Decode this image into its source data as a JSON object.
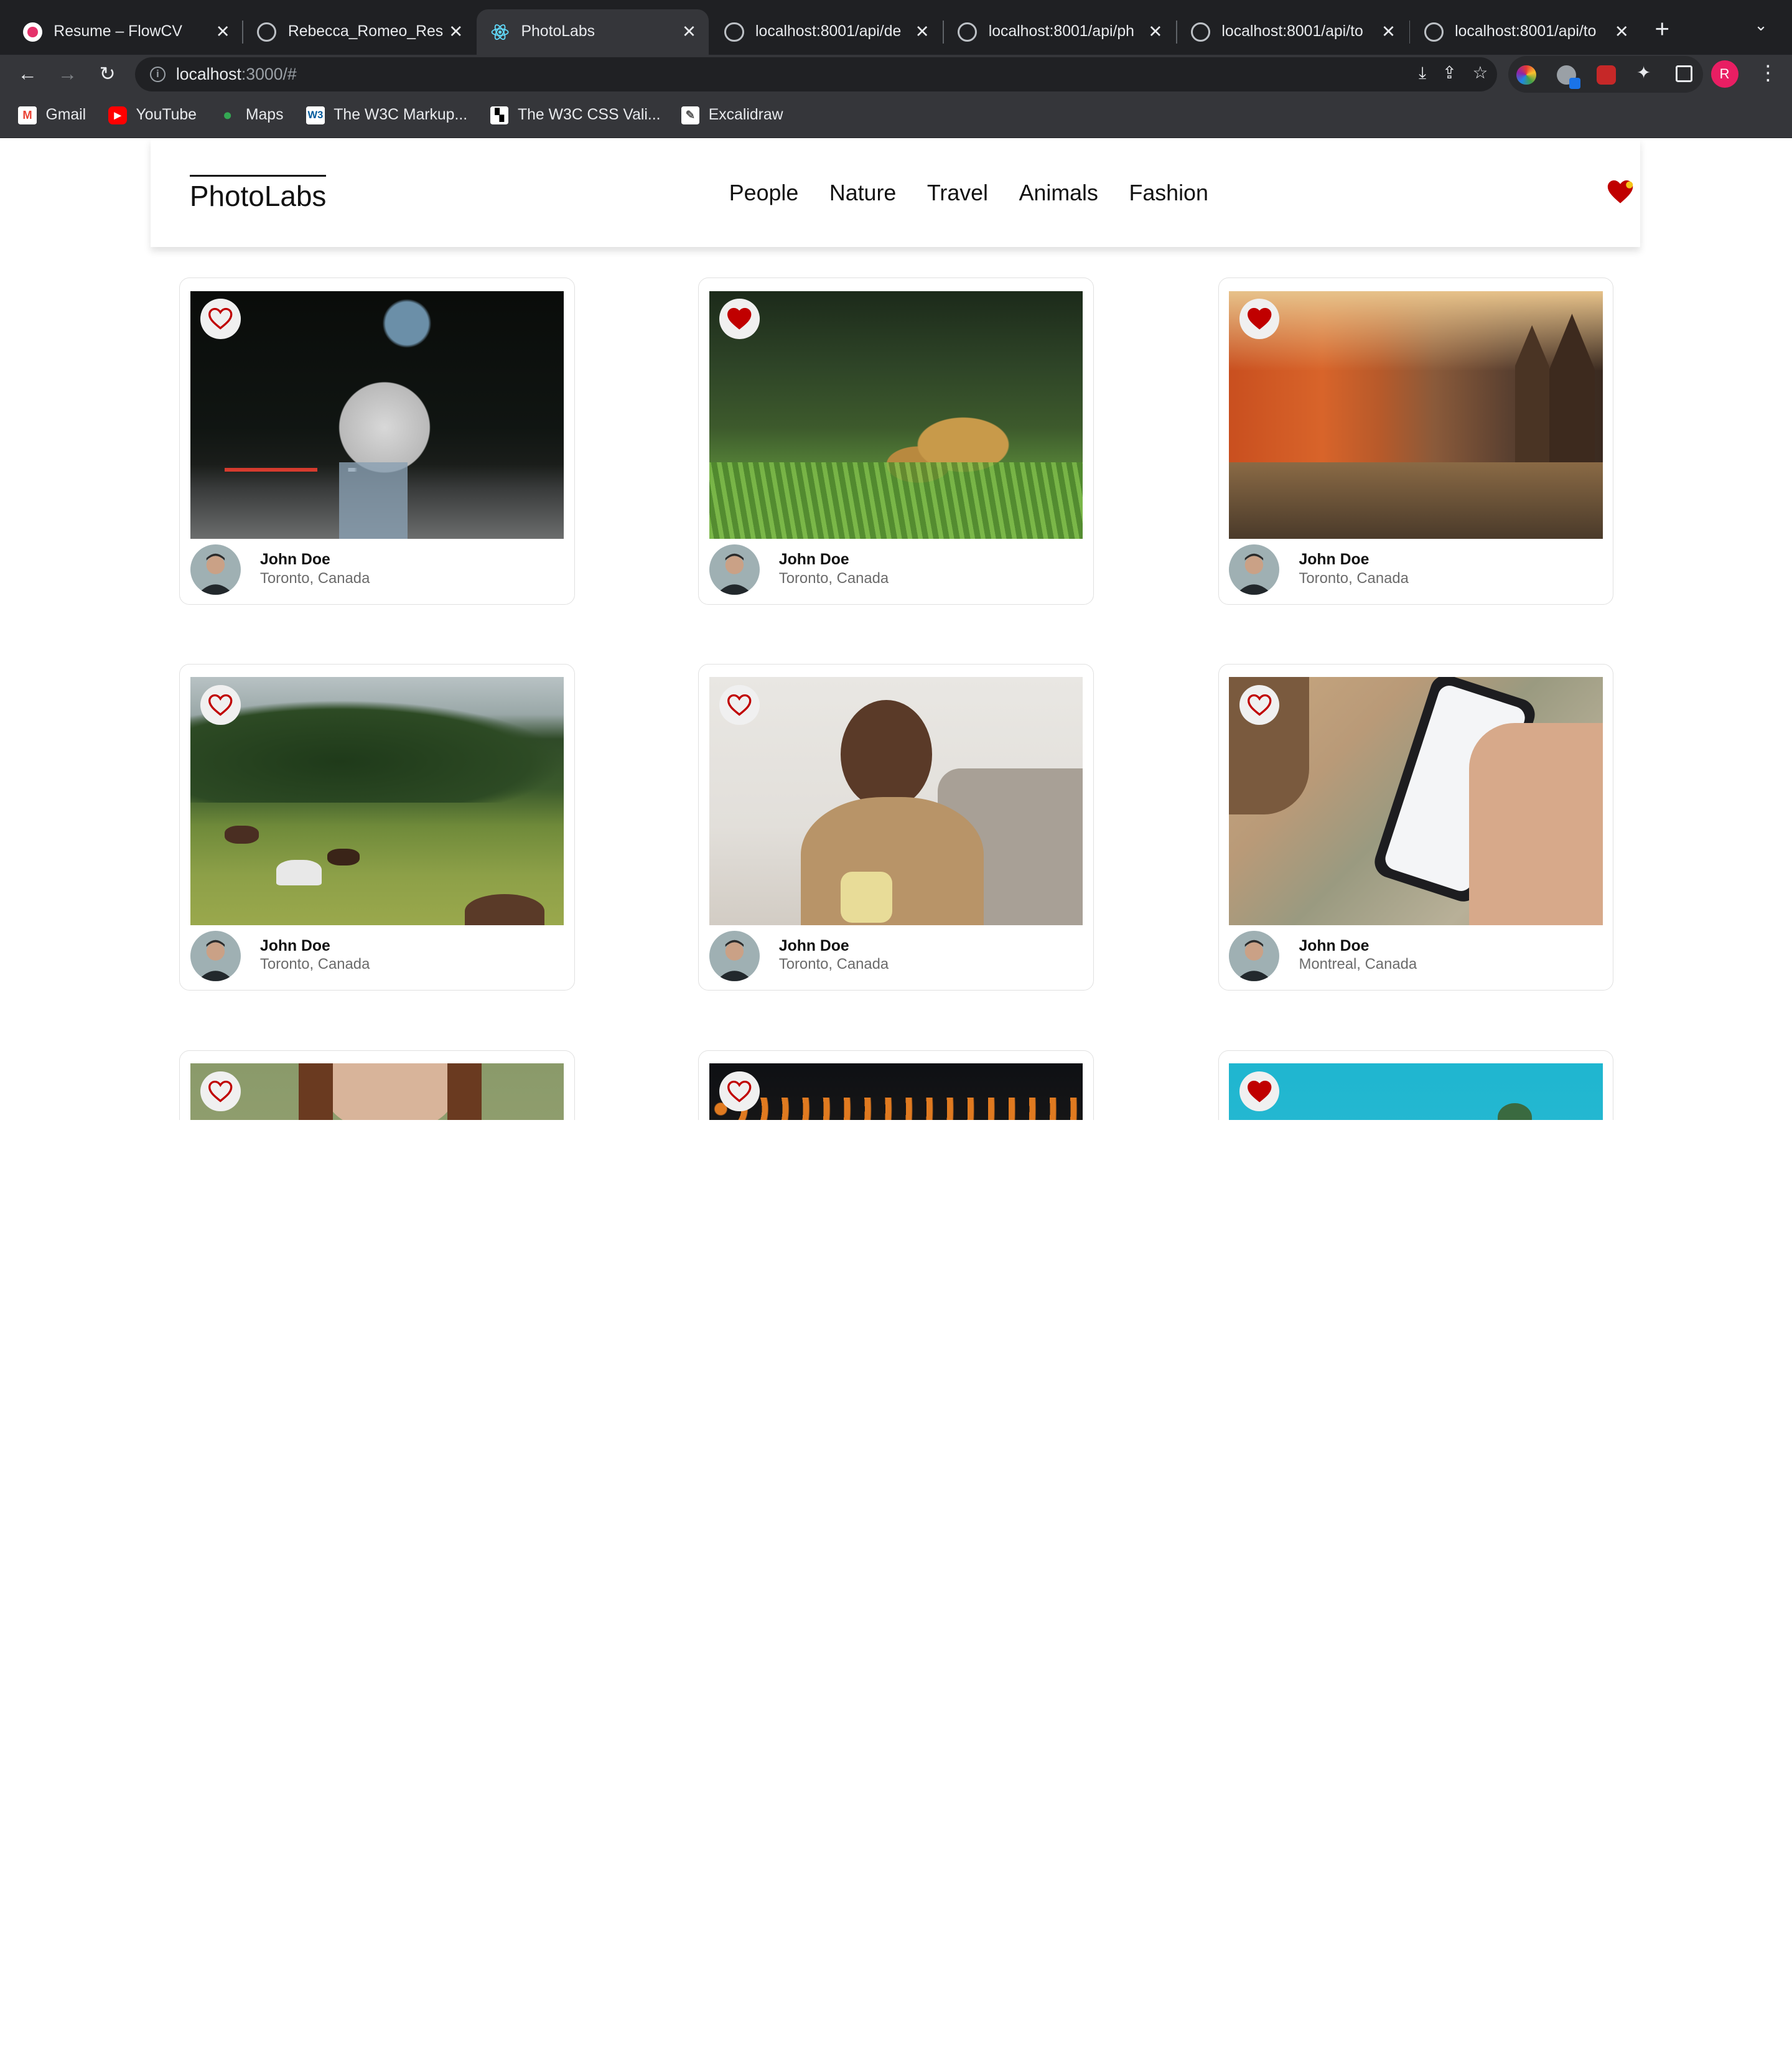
{
  "browser": {
    "tabs": [
      {
        "title": "Resume – FlowCV"
      },
      {
        "title": "Rebecca_Romeo_Res"
      },
      {
        "title": "PhotoLabs"
      },
      {
        "title": "localhost:8001/api/de"
      },
      {
        "title": "localhost:8001/api/ph"
      },
      {
        "title": "localhost:8001/api/to"
      },
      {
        "title": "localhost:8001/api/to"
      }
    ],
    "url_host": "localhost",
    "url_rest": ":3000/#",
    "profile_initial": "R",
    "bookmarks": [
      {
        "label": "Gmail"
      },
      {
        "label": "YouTube"
      },
      {
        "label": "Maps"
      },
      {
        "label": "The W3C Markup..."
      },
      {
        "label": "The W3C CSS Vali..."
      },
      {
        "label": "Excalidraw"
      }
    ]
  },
  "app": {
    "logo": "PhotoLabs",
    "topics": [
      "People",
      "Nature",
      "Travel",
      "Animals",
      "Fashion"
    ],
    "accent_color": "#c00000",
    "photos": [
      {
        "user": "John Doe",
        "location": "Toronto, Canada",
        "favourited": false,
        "scene": "man walking at night street"
      },
      {
        "user": "John Doe",
        "location": "Toronto, Canada",
        "favourited": true,
        "scene": "jaguar in grass"
      },
      {
        "user": "John Doe",
        "location": "Toronto, Canada",
        "favourited": true,
        "scene": "orange buildings and temple"
      },
      {
        "user": "John Doe",
        "location": "Toronto, Canada",
        "favourited": false,
        "scene": "horses grazing on hill"
      },
      {
        "user": "John Doe",
        "location": "Toronto, Canada",
        "favourited": false,
        "scene": "smiling man with mug"
      },
      {
        "user": "John Doe",
        "location": "Montreal, Canada",
        "favourited": false,
        "scene": "hand holding phone"
      },
      {
        "user": "",
        "location": "",
        "favourited": false,
        "scene": "woman portrait"
      },
      {
        "user": "",
        "location": "",
        "favourited": false,
        "scene": "orange flowers at night"
      },
      {
        "user": "",
        "location": "",
        "favourited": true,
        "scene": "turquoise sky palm"
      }
    ]
  }
}
